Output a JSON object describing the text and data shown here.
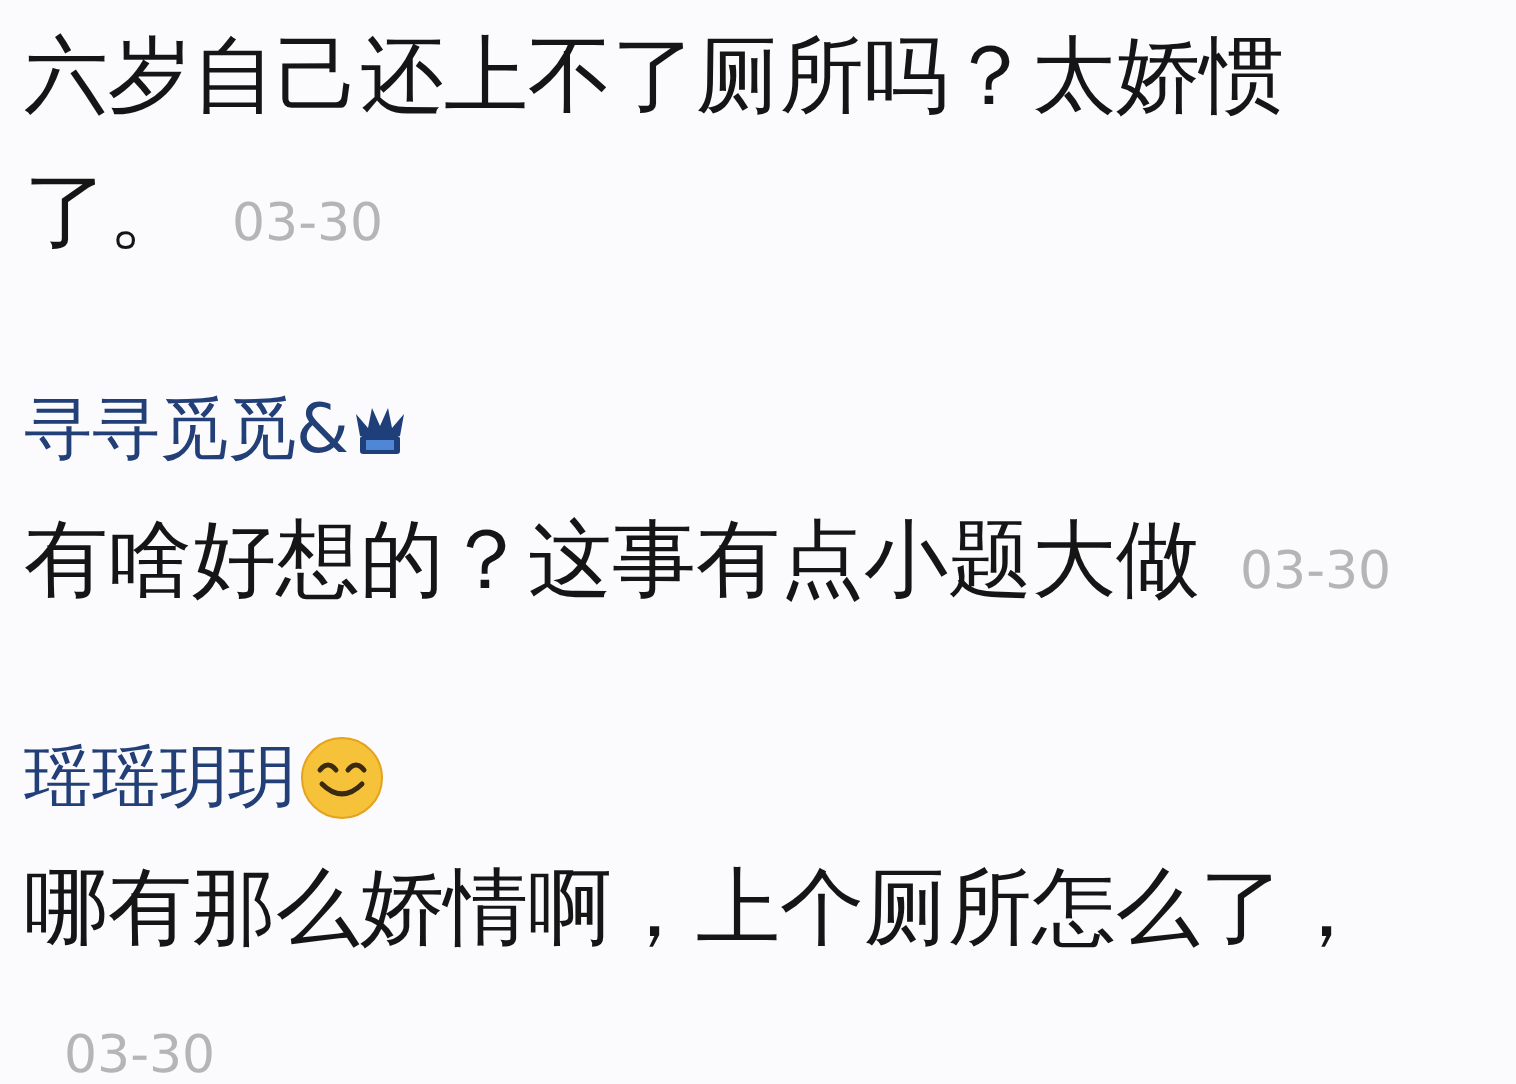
{
  "comments": [
    {
      "kind": "plain",
      "lines": [
        "六岁自己还上不了厕所吗？太娇惯",
        "了。"
      ],
      "time": "03-30"
    },
    {
      "kind": "crowned",
      "user": "寻寻觅觅&",
      "lines": [
        "有啥好想的？这事有点小题大做"
      ],
      "time": "03-30"
    },
    {
      "kind": "smiling",
      "user": "瑶瑶玥玥",
      "lines": [
        "哪有那么娇情啊，上个厕所怎么了，"
      ],
      "time": "03-30"
    }
  ]
}
